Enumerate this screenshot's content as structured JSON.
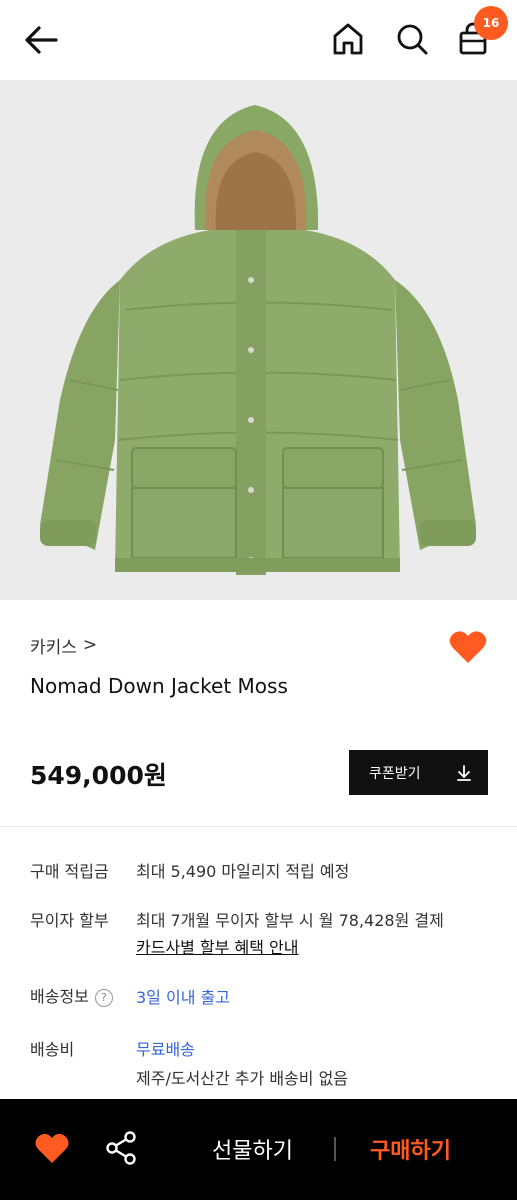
{
  "header": {
    "cart_count": "16"
  },
  "product": {
    "brand": "카키스",
    "brand_chevron": ">",
    "name": "Nomad Down Jacket Moss",
    "price": "549,000원",
    "coupon_label": "쿠폰받기",
    "favorite": true
  },
  "info": {
    "points_label": "구매 적립금",
    "points_value": "최대 5,490 마일리지 적립 예정",
    "installment_label": "무이자 할부",
    "installment_value": "최대 7개월 무이자 할부 시 월 78,428원 결제",
    "installment_link": "카드사별 할부 혜택 안내",
    "shipping_info_label": "배송정보",
    "shipping_info_help": "?",
    "shipping_info_value": "3일 이내 출고",
    "shipping_fee_label": "배송비",
    "shipping_fee_value": "무료배송",
    "shipping_fee_note": "제주/도서산간 추가 배송비 없음"
  },
  "bottom": {
    "gift_label": "선물하기",
    "buy_label": "구매하기"
  },
  "colors": {
    "accent": "#ff5a1f",
    "link_blue": "#3366dd",
    "jacket_green": "#8fae6b"
  }
}
